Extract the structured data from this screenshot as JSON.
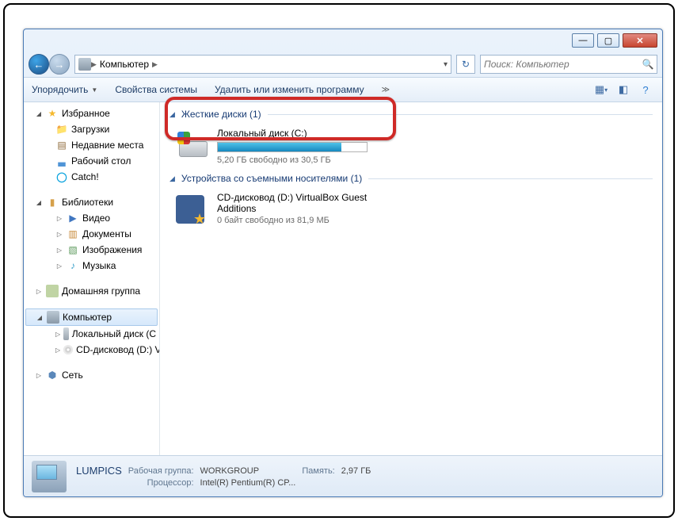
{
  "breadcrumb": {
    "root_glyph": "▇",
    "segment": "Компьютер"
  },
  "search": {
    "placeholder": "Поиск: Компьютер"
  },
  "toolbar": {
    "organize": "Упорядочить",
    "properties": "Свойства системы",
    "uninstall": "Удалить или изменить программу"
  },
  "sidebar": {
    "favorites": {
      "label": "Избранное",
      "items": [
        {
          "label": "Загрузки"
        },
        {
          "label": "Недавние места"
        },
        {
          "label": "Рабочий стол"
        },
        {
          "label": "Catch!"
        }
      ]
    },
    "libraries": {
      "label": "Библиотеки",
      "items": [
        {
          "label": "Видео"
        },
        {
          "label": "Документы"
        },
        {
          "label": "Изображения"
        },
        {
          "label": "Музыка"
        }
      ]
    },
    "homegroup": {
      "label": "Домашняя группа"
    },
    "computer": {
      "label": "Компьютер",
      "items": [
        {
          "label": "Локальный диск (C"
        },
        {
          "label": "CD-дисковод (D:) Vi"
        }
      ]
    },
    "network": {
      "label": "Сеть"
    }
  },
  "groups": [
    {
      "header": "Жесткие диски (1)",
      "items": [
        {
          "name": "Локальный диск (C:)",
          "free_text": "5,20 ГБ свободно из 30,5 ГБ",
          "fill_percent": 83
        }
      ]
    },
    {
      "header": "Устройства со съемными носителями (1)",
      "items": [
        {
          "name": "CD-дисковод (D:) VirtualBox Guest Additions",
          "free_text": "0 байт свободно из 81,9 МБ"
        }
      ]
    }
  ],
  "status": {
    "name": "LUMPICS",
    "workgroup_label": "Рабочая группа:",
    "workgroup": "WORKGROUP",
    "memory_label": "Память:",
    "memory": "2,97 ГБ",
    "cpu_label": "Процессор:",
    "cpu": "Intel(R) Pentium(R) CP..."
  }
}
